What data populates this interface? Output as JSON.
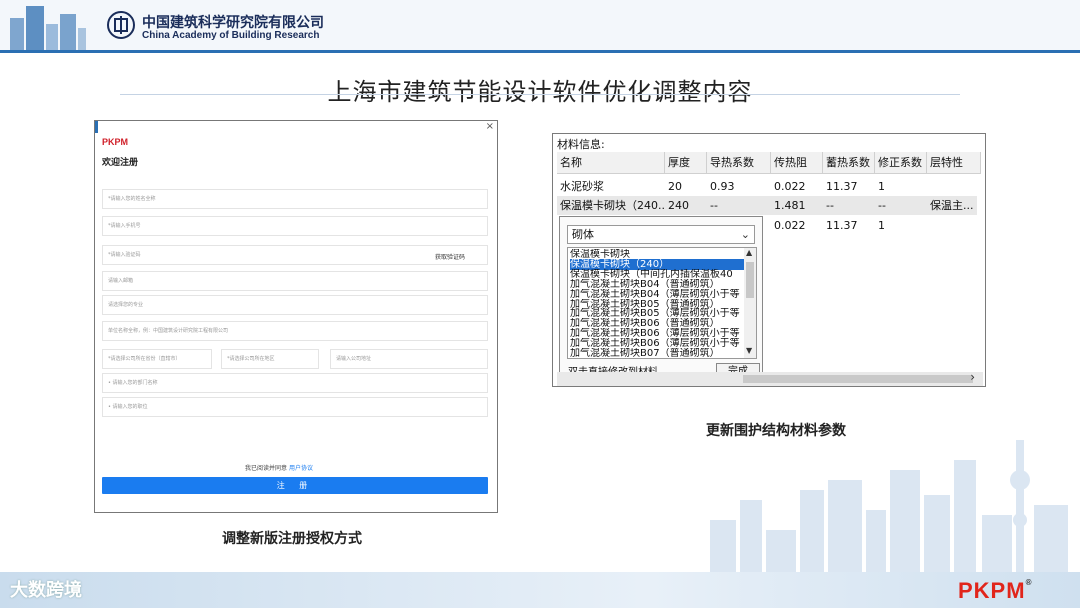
{
  "header": {
    "org_name_cn": "中国建筑科学研究院有限公司",
    "org_name_en": "China Academy of Building Research"
  },
  "slide_title": "上海市建筑节能设计软件优化调整内容",
  "register_form": {
    "brand": "PKPM",
    "close": "×",
    "title": "欢迎注册",
    "fields": {
      "name": "*请输入您的姓名全称",
      "phone": "*请输入手机号",
      "code": "*请输入验证码",
      "get_code": "获取验证码",
      "email": "请输入邮箱",
      "profession": "请选择您的专业",
      "company": "单位名称全称，例：中国建筑设计研究院工程有限公司",
      "province": "*请选择公司所在省份（直辖市）",
      "district": "*请选择公司所在地区",
      "address": "请输入公司地址",
      "department": "• 请输入您的部门名称",
      "position": "• 请输入您的职位"
    },
    "agree_text": "我已阅读并同意",
    "agree_link": "用户协议",
    "submit": "注 册",
    "caption": "调整新版注册授权方式"
  },
  "material_panel": {
    "label": "材料信息:",
    "columns": [
      "名称",
      "厚度",
      "导热系数",
      "传热阻",
      "蓄热系数",
      "修正系数",
      "层特性"
    ],
    "rows": [
      [
        "水泥砂浆",
        "20",
        "0.93",
        "0.022",
        "11.37",
        "1",
        ""
      ],
      [
        "保温模卡砌块（240...",
        "240",
        "--",
        "1.481",
        "--",
        "--",
        "保温主..."
      ],
      [
        "",
        "",
        "",
        "0.022",
        "11.37",
        "1",
        ""
      ]
    ],
    "combo_value": "砌体",
    "list_items": [
      "保温模卡砌块",
      "保温模卡砌块（240）",
      "保温模卡砌块（中间孔内插保温板40",
      "加气混凝土砌块B04（普通砌筑）",
      "加气混凝土砌块B04（薄层砌筑小于等",
      "加气混凝土砌块B05（普通砌筑）",
      "加气混凝土砌块B05（薄层砌筑小于等",
      "加气混凝土砌块B06（普通砌筑）",
      "加气混凝土砌块B06（薄层砌筑小于等",
      "加气混凝土砌块B06（薄层砌筑小于等",
      "加气混凝土砌块B07（普通砌筑）"
    ],
    "selected_index": 1,
    "hint": "双击直接修改到材料",
    "done": "完成",
    "caption": "更新围护结构材料参数"
  },
  "footer": {
    "watermark": "大数跨境",
    "brand": "PKPM",
    "brand_reg": "®"
  },
  "colors": {
    "accent_blue": "#2a6fb3",
    "button_blue": "#1a7cf0",
    "selection_blue": "#1f6fd0",
    "brand_red": "#e1251b"
  }
}
